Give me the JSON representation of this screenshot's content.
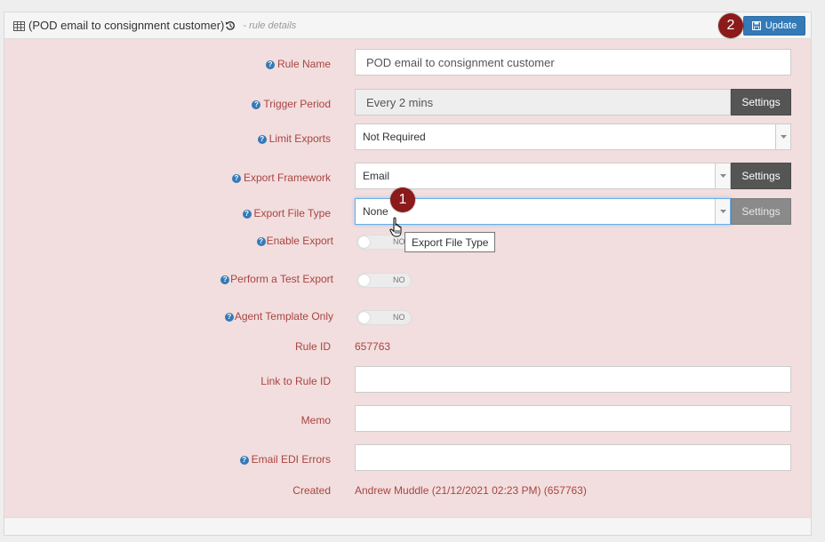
{
  "header": {
    "title": "(POD email to consignment customer)",
    "subtitle": "- rule details",
    "update_label": "Update"
  },
  "badges": {
    "one": "1",
    "two": "2"
  },
  "fields": {
    "rule_name": {
      "label": "Rule Name",
      "value": "POD email to consignment customer"
    },
    "trigger_period": {
      "label": "Trigger Period",
      "value": "Every 2 mins",
      "button": "Settings"
    },
    "limit_exports": {
      "label": "Limit Exports",
      "value": "Not Required"
    },
    "export_framework": {
      "label": "Export Framework",
      "value": "Email",
      "button": "Settings"
    },
    "export_file_type": {
      "label": "Export File Type",
      "value": "None",
      "button": "Settings"
    },
    "enable_export": {
      "label": "Enable Export",
      "toggle": "NO"
    },
    "perform_test_export": {
      "label": "Perform a Test Export",
      "toggle": "NO"
    },
    "agent_template_only": {
      "label": "Agent Template Only",
      "toggle": "NO"
    },
    "rule_id": {
      "label": "Rule ID",
      "value": "657763"
    },
    "link_to_rule_id": {
      "label": "Link to Rule ID",
      "value": ""
    },
    "memo": {
      "label": "Memo",
      "value": ""
    },
    "email_edi_errors": {
      "label": "Email EDI Errors",
      "value": ""
    },
    "created": {
      "label": "Created",
      "value": "Andrew Muddle (21/12/2021 02:23 PM) (657763)"
    }
  },
  "tooltip": {
    "text": "Export File Type"
  },
  "icons": {
    "table": "table-icon",
    "history": "history-icon",
    "save": "save-icon",
    "help": "question-circle-icon",
    "caret": "caret-down-icon",
    "cursor": "hand-pointer-icon"
  },
  "colors": {
    "panel_bg": "#f2dede",
    "label": "#a94442",
    "primary": "#337ab7",
    "badge": "#8b1a1a",
    "settings_button": "#555555"
  }
}
